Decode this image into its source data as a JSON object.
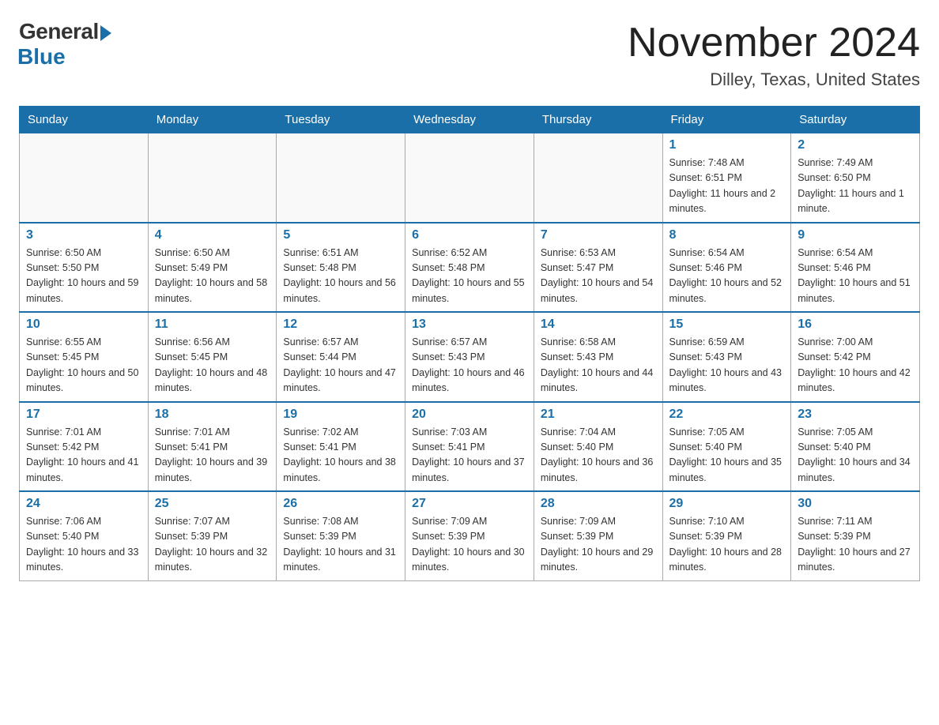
{
  "logo": {
    "general": "General",
    "blue": "Blue"
  },
  "title": "November 2024",
  "location": "Dilley, Texas, United States",
  "headers": [
    "Sunday",
    "Monday",
    "Tuesday",
    "Wednesday",
    "Thursday",
    "Friday",
    "Saturday"
  ],
  "weeks": [
    [
      {
        "day": "",
        "info": ""
      },
      {
        "day": "",
        "info": ""
      },
      {
        "day": "",
        "info": ""
      },
      {
        "day": "",
        "info": ""
      },
      {
        "day": "",
        "info": ""
      },
      {
        "day": "1",
        "info": "Sunrise: 7:48 AM\nSunset: 6:51 PM\nDaylight: 11 hours and 2 minutes."
      },
      {
        "day": "2",
        "info": "Sunrise: 7:49 AM\nSunset: 6:50 PM\nDaylight: 11 hours and 1 minute."
      }
    ],
    [
      {
        "day": "3",
        "info": "Sunrise: 6:50 AM\nSunset: 5:50 PM\nDaylight: 10 hours and 59 minutes."
      },
      {
        "day": "4",
        "info": "Sunrise: 6:50 AM\nSunset: 5:49 PM\nDaylight: 10 hours and 58 minutes."
      },
      {
        "day": "5",
        "info": "Sunrise: 6:51 AM\nSunset: 5:48 PM\nDaylight: 10 hours and 56 minutes."
      },
      {
        "day": "6",
        "info": "Sunrise: 6:52 AM\nSunset: 5:48 PM\nDaylight: 10 hours and 55 minutes."
      },
      {
        "day": "7",
        "info": "Sunrise: 6:53 AM\nSunset: 5:47 PM\nDaylight: 10 hours and 54 minutes."
      },
      {
        "day": "8",
        "info": "Sunrise: 6:54 AM\nSunset: 5:46 PM\nDaylight: 10 hours and 52 minutes."
      },
      {
        "day": "9",
        "info": "Sunrise: 6:54 AM\nSunset: 5:46 PM\nDaylight: 10 hours and 51 minutes."
      }
    ],
    [
      {
        "day": "10",
        "info": "Sunrise: 6:55 AM\nSunset: 5:45 PM\nDaylight: 10 hours and 50 minutes."
      },
      {
        "day": "11",
        "info": "Sunrise: 6:56 AM\nSunset: 5:45 PM\nDaylight: 10 hours and 48 minutes."
      },
      {
        "day": "12",
        "info": "Sunrise: 6:57 AM\nSunset: 5:44 PM\nDaylight: 10 hours and 47 minutes."
      },
      {
        "day": "13",
        "info": "Sunrise: 6:57 AM\nSunset: 5:43 PM\nDaylight: 10 hours and 46 minutes."
      },
      {
        "day": "14",
        "info": "Sunrise: 6:58 AM\nSunset: 5:43 PM\nDaylight: 10 hours and 44 minutes."
      },
      {
        "day": "15",
        "info": "Sunrise: 6:59 AM\nSunset: 5:43 PM\nDaylight: 10 hours and 43 minutes."
      },
      {
        "day": "16",
        "info": "Sunrise: 7:00 AM\nSunset: 5:42 PM\nDaylight: 10 hours and 42 minutes."
      }
    ],
    [
      {
        "day": "17",
        "info": "Sunrise: 7:01 AM\nSunset: 5:42 PM\nDaylight: 10 hours and 41 minutes."
      },
      {
        "day": "18",
        "info": "Sunrise: 7:01 AM\nSunset: 5:41 PM\nDaylight: 10 hours and 39 minutes."
      },
      {
        "day": "19",
        "info": "Sunrise: 7:02 AM\nSunset: 5:41 PM\nDaylight: 10 hours and 38 minutes."
      },
      {
        "day": "20",
        "info": "Sunrise: 7:03 AM\nSunset: 5:41 PM\nDaylight: 10 hours and 37 minutes."
      },
      {
        "day": "21",
        "info": "Sunrise: 7:04 AM\nSunset: 5:40 PM\nDaylight: 10 hours and 36 minutes."
      },
      {
        "day": "22",
        "info": "Sunrise: 7:05 AM\nSunset: 5:40 PM\nDaylight: 10 hours and 35 minutes."
      },
      {
        "day": "23",
        "info": "Sunrise: 7:05 AM\nSunset: 5:40 PM\nDaylight: 10 hours and 34 minutes."
      }
    ],
    [
      {
        "day": "24",
        "info": "Sunrise: 7:06 AM\nSunset: 5:40 PM\nDaylight: 10 hours and 33 minutes."
      },
      {
        "day": "25",
        "info": "Sunrise: 7:07 AM\nSunset: 5:39 PM\nDaylight: 10 hours and 32 minutes."
      },
      {
        "day": "26",
        "info": "Sunrise: 7:08 AM\nSunset: 5:39 PM\nDaylight: 10 hours and 31 minutes."
      },
      {
        "day": "27",
        "info": "Sunrise: 7:09 AM\nSunset: 5:39 PM\nDaylight: 10 hours and 30 minutes."
      },
      {
        "day": "28",
        "info": "Sunrise: 7:09 AM\nSunset: 5:39 PM\nDaylight: 10 hours and 29 minutes."
      },
      {
        "day": "29",
        "info": "Sunrise: 7:10 AM\nSunset: 5:39 PM\nDaylight: 10 hours and 28 minutes."
      },
      {
        "day": "30",
        "info": "Sunrise: 7:11 AM\nSunset: 5:39 PM\nDaylight: 10 hours and 27 minutes."
      }
    ]
  ]
}
